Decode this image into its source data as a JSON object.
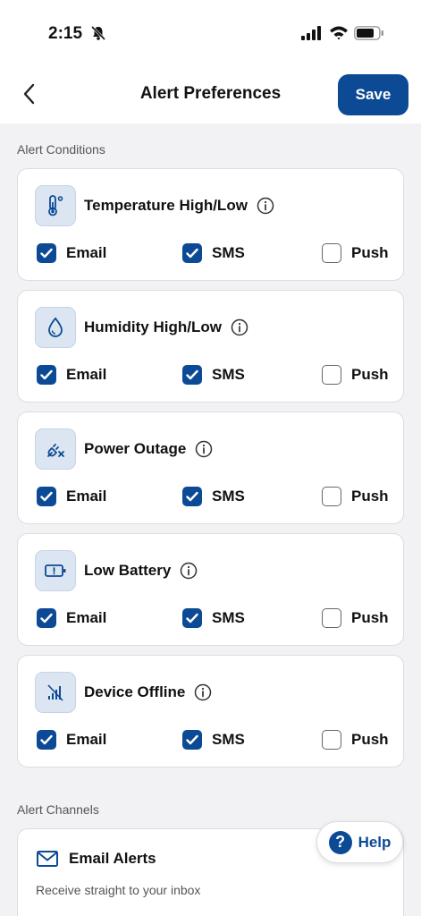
{
  "status_bar": {
    "time": "2:15"
  },
  "header": {
    "title": "Alert Preferences",
    "save_label": "Save"
  },
  "sections": {
    "conditions_label": "Alert Conditions",
    "channels_label": "Alert Channels"
  },
  "options": {
    "email": "Email",
    "sms": "SMS",
    "push": "Push"
  },
  "conditions": [
    {
      "title": "Temperature High/Low",
      "icon": "thermometer-icon",
      "email": true,
      "sms": true,
      "push": false
    },
    {
      "title": "Humidity High/Low",
      "icon": "droplet-icon",
      "email": true,
      "sms": true,
      "push": false
    },
    {
      "title": "Power Outage",
      "icon": "power-plug-off-icon",
      "email": true,
      "sms": true,
      "push": false
    },
    {
      "title": "Low Battery",
      "icon": "battery-alert-icon",
      "email": true,
      "sms": true,
      "push": false
    },
    {
      "title": "Device Offline",
      "icon": "signal-off-icon",
      "email": true,
      "sms": true,
      "push": false
    }
  ],
  "channels": [
    {
      "title": "Email Alerts",
      "description": "Receive straight to your inbox",
      "icon": "mail-icon"
    }
  ],
  "help": {
    "label": "Help"
  },
  "colors": {
    "accent": "#0d4a95",
    "icon_box": "#dce6f2",
    "background": "#f2f2f4"
  }
}
